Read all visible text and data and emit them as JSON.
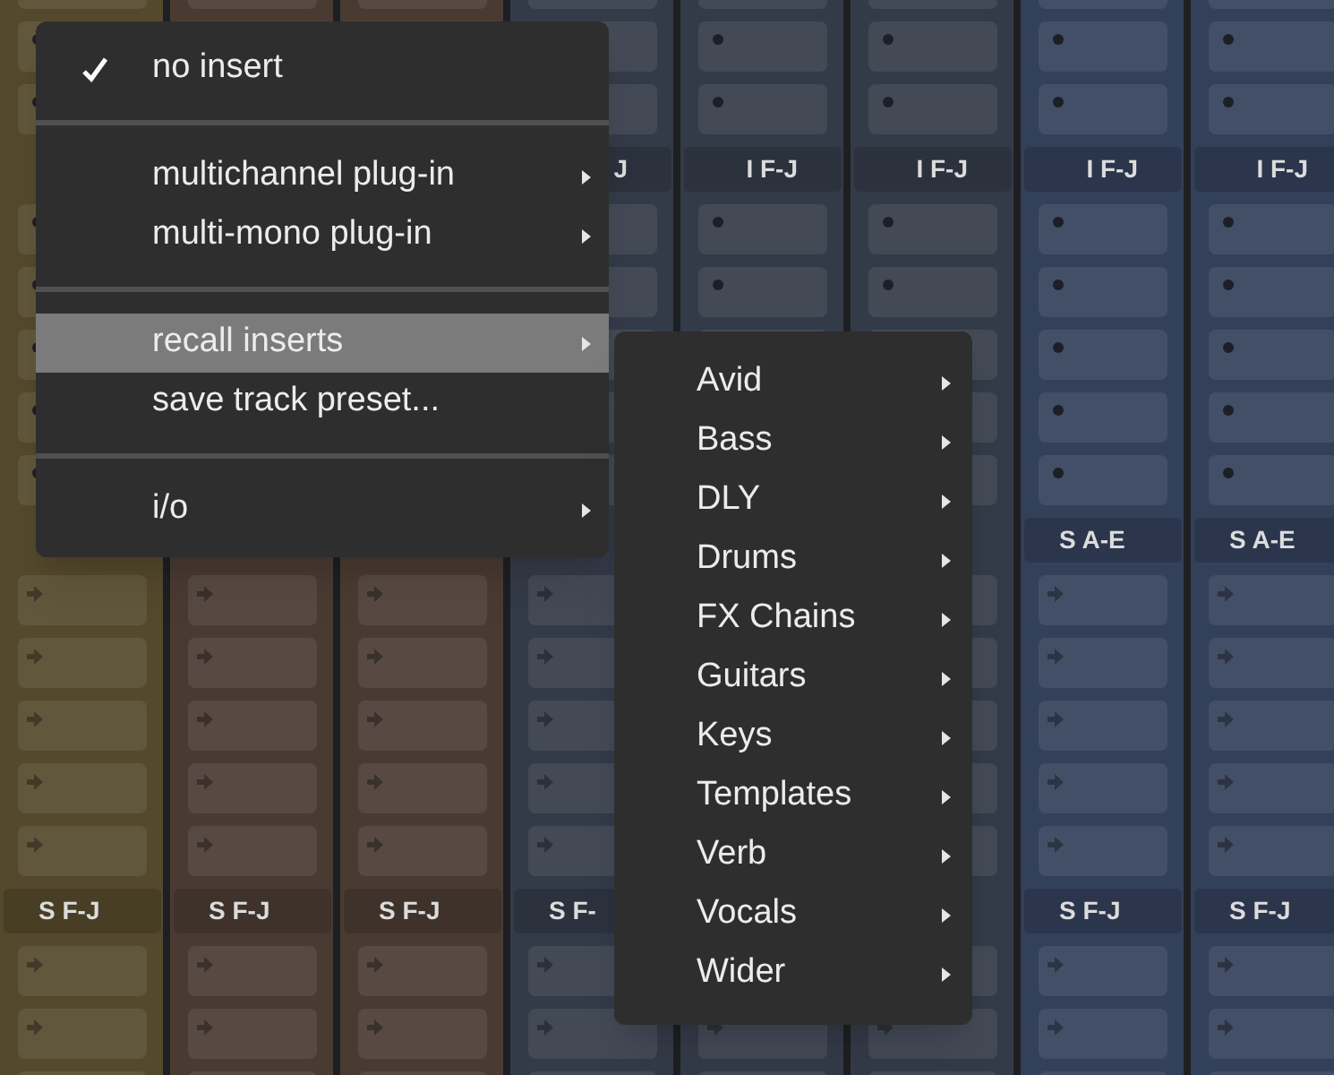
{
  "mixer": {
    "strips": [
      {
        "color": "#54492c",
        "send_b_label": {
          "text": "S F-J"
        }
      },
      {
        "color": "#4a3b32",
        "send_b_label": {
          "text": "S F-J"
        }
      },
      {
        "color": "#4a3b32",
        "send_b_label": {
          "text": "S F-J"
        }
      },
      {
        "color": "#343b48",
        "insert_label": {
          "text": "J"
        },
        "send_b_label": {
          "text": "S F-"
        }
      },
      {
        "color": "#343b48",
        "insert_label": {
          "text": "I F-J"
        }
      },
      {
        "color": "#343b48",
        "insert_label": {
          "text": "I F-J"
        }
      },
      {
        "color": "#33405a",
        "insert_label": {
          "text": "I F-J"
        },
        "send_a_label": {
          "text": "S A-E"
        },
        "send_b_label": {
          "text": "S F-J"
        }
      },
      {
        "color": "#33405a",
        "insert_label": {
          "text": "I F-J"
        },
        "send_a_label": {
          "text": "S A-E"
        },
        "send_b_label": {
          "text": "S F-J"
        }
      }
    ]
  },
  "menu": {
    "items": [
      {
        "kind": "item",
        "label": "no insert",
        "checked": true,
        "selected": false,
        "has_submenu": false
      },
      {
        "kind": "separator"
      },
      {
        "kind": "item",
        "label": "multichannel plug-in",
        "checked": false,
        "selected": false,
        "has_submenu": true
      },
      {
        "kind": "item",
        "label": "multi-mono plug-in",
        "checked": false,
        "selected": false,
        "has_submenu": true
      },
      {
        "kind": "separator"
      },
      {
        "kind": "item",
        "label": "recall inserts",
        "checked": false,
        "selected": true,
        "has_submenu": true
      },
      {
        "kind": "item",
        "label": "save track preset...",
        "checked": false,
        "selected": false,
        "has_submenu": false
      },
      {
        "kind": "separator"
      },
      {
        "kind": "item",
        "label": "i/o",
        "checked": false,
        "selected": false,
        "has_submenu": true
      }
    ]
  },
  "submenu": {
    "items": [
      {
        "label": "Avid",
        "has_submenu": true
      },
      {
        "label": "Bass",
        "has_submenu": true
      },
      {
        "label": "DLY",
        "has_submenu": true
      },
      {
        "label": "Drums",
        "has_submenu": true
      },
      {
        "label": "FX Chains",
        "has_submenu": true
      },
      {
        "label": "Guitars",
        "has_submenu": true
      },
      {
        "label": "Keys",
        "has_submenu": true
      },
      {
        "label": "Templates",
        "has_submenu": true
      },
      {
        "label": "Verb",
        "has_submenu": true
      },
      {
        "label": "Vocals",
        "has_submenu": true
      },
      {
        "label": "Wider",
        "has_submenu": true
      }
    ]
  }
}
